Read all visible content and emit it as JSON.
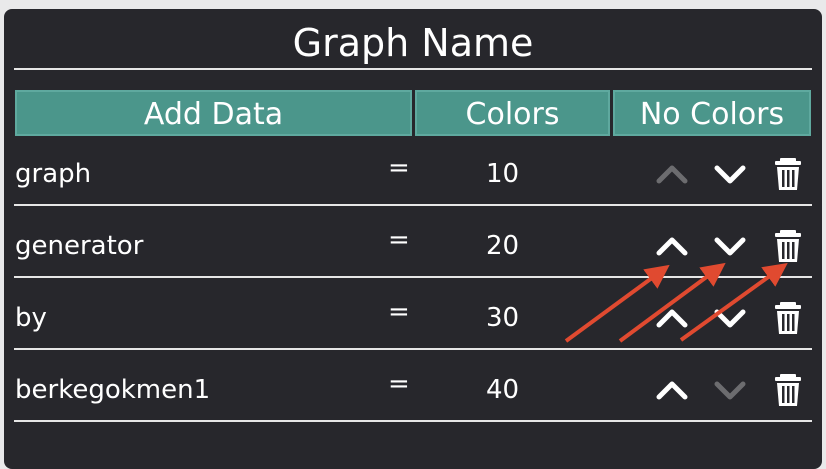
{
  "graph": {
    "title": "Graph Name"
  },
  "buttons": {
    "add_data": "Add Data",
    "colors": "Colors",
    "no_colors": "No Colors"
  },
  "rows": [
    {
      "label": "graph",
      "eq": "=",
      "value": "10",
      "up_enabled": false,
      "down_enabled": true
    },
    {
      "label": "generator",
      "eq": "=",
      "value": "20",
      "up_enabled": true,
      "down_enabled": true
    },
    {
      "label": "by",
      "eq": "=",
      "value": "30",
      "up_enabled": true,
      "down_enabled": true
    },
    {
      "label": "berkegokmen1",
      "eq": "=",
      "value": "40",
      "up_enabled": true,
      "down_enabled": false
    }
  ],
  "icons": {
    "up": "chevron-up-icon",
    "down": "chevron-down-icon",
    "delete": "trash-icon"
  },
  "colors": {
    "panel_bg": "#27272c",
    "button_bg": "#4b968b",
    "icon_enabled": "#ffffff",
    "icon_disabled": "#7a7a7d",
    "annotation_arrow": "#e04a30"
  }
}
